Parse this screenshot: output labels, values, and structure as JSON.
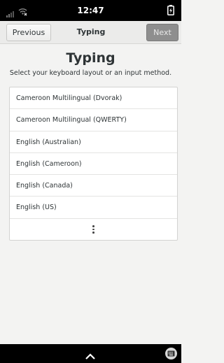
{
  "status_bar": {
    "time": "12:47",
    "signal_icon": "signal-bars-icon",
    "wifi_icon": "wifi-off-icon",
    "battery_icon": "battery-charging-icon"
  },
  "header": {
    "previous_label": "Previous",
    "title": "Typing",
    "next_label": "Next"
  },
  "main": {
    "title": "Typing",
    "subtitle": "Select your keyboard layout or an input method.",
    "layouts": [
      "Cameroon Multilingual (Dvorak)",
      "Cameroon Multilingual (QWERTY)",
      "English (Australian)",
      "English (Cameroon)",
      "English (Canada)",
      "English (US)"
    ],
    "more_icon": "kebab-more-icon"
  },
  "bottom_bar": {
    "handle_icon": "chevron-up-icon",
    "keyboard_icon": "keyboard-icon"
  },
  "colors": {
    "background": "#f3f3f2",
    "next_button": "#8e8e8e",
    "bars": "#000000"
  }
}
